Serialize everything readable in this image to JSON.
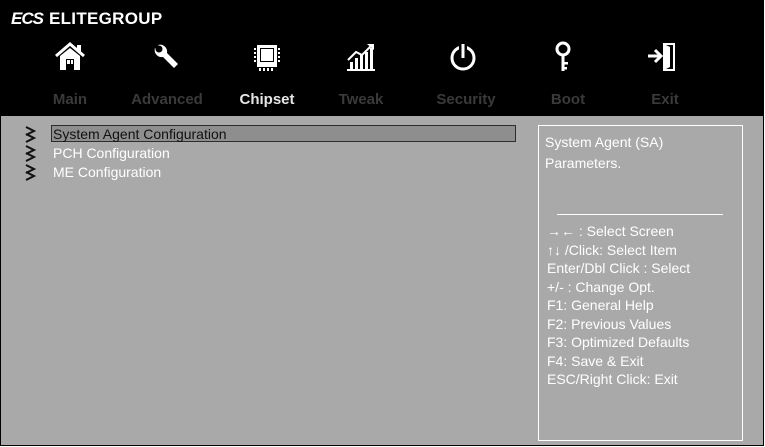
{
  "brand": {
    "logo": "ECS",
    "name": "ELITEGROUP"
  },
  "icons": [
    "home-icon",
    "wrench-icon",
    "chip-icon",
    "chart-icon",
    "power-icon",
    "key-icon",
    "exit-icon"
  ],
  "tabs": [
    {
      "label": "Main"
    },
    {
      "label": "Advanced"
    },
    {
      "label": "Chipset"
    },
    {
      "label": "Tweak"
    },
    {
      "label": "Security"
    },
    {
      "label": "Boot"
    },
    {
      "label": "Exit"
    }
  ],
  "active_tab": "Chipset",
  "menu": {
    "items": [
      {
        "label": "System Agent Configuration",
        "selected": true
      },
      {
        "label": "PCH Configuration",
        "selected": false
      },
      {
        "label": "ME Configuration",
        "selected": false
      }
    ]
  },
  "help": {
    "description": [
      "System Agent (SA)",
      "Parameters."
    ],
    "keys": [
      "→←   : Select Screen",
      "↑↓ /Click: Select Item",
      "Enter/Dbl Click : Select",
      " +/- : Change Opt.",
      "F1: General Help",
      "F2: Previous Values",
      "F3: Optimized Defaults",
      "F4: Save & Exit",
      "ESC/Right Click: Exit"
    ]
  },
  "colors": {
    "background": "#a9a9aa",
    "topbar": "#000000",
    "active_tab": "#e6e6e6",
    "inactive_tab": "#3a3a3a",
    "text": "#ffffff"
  }
}
